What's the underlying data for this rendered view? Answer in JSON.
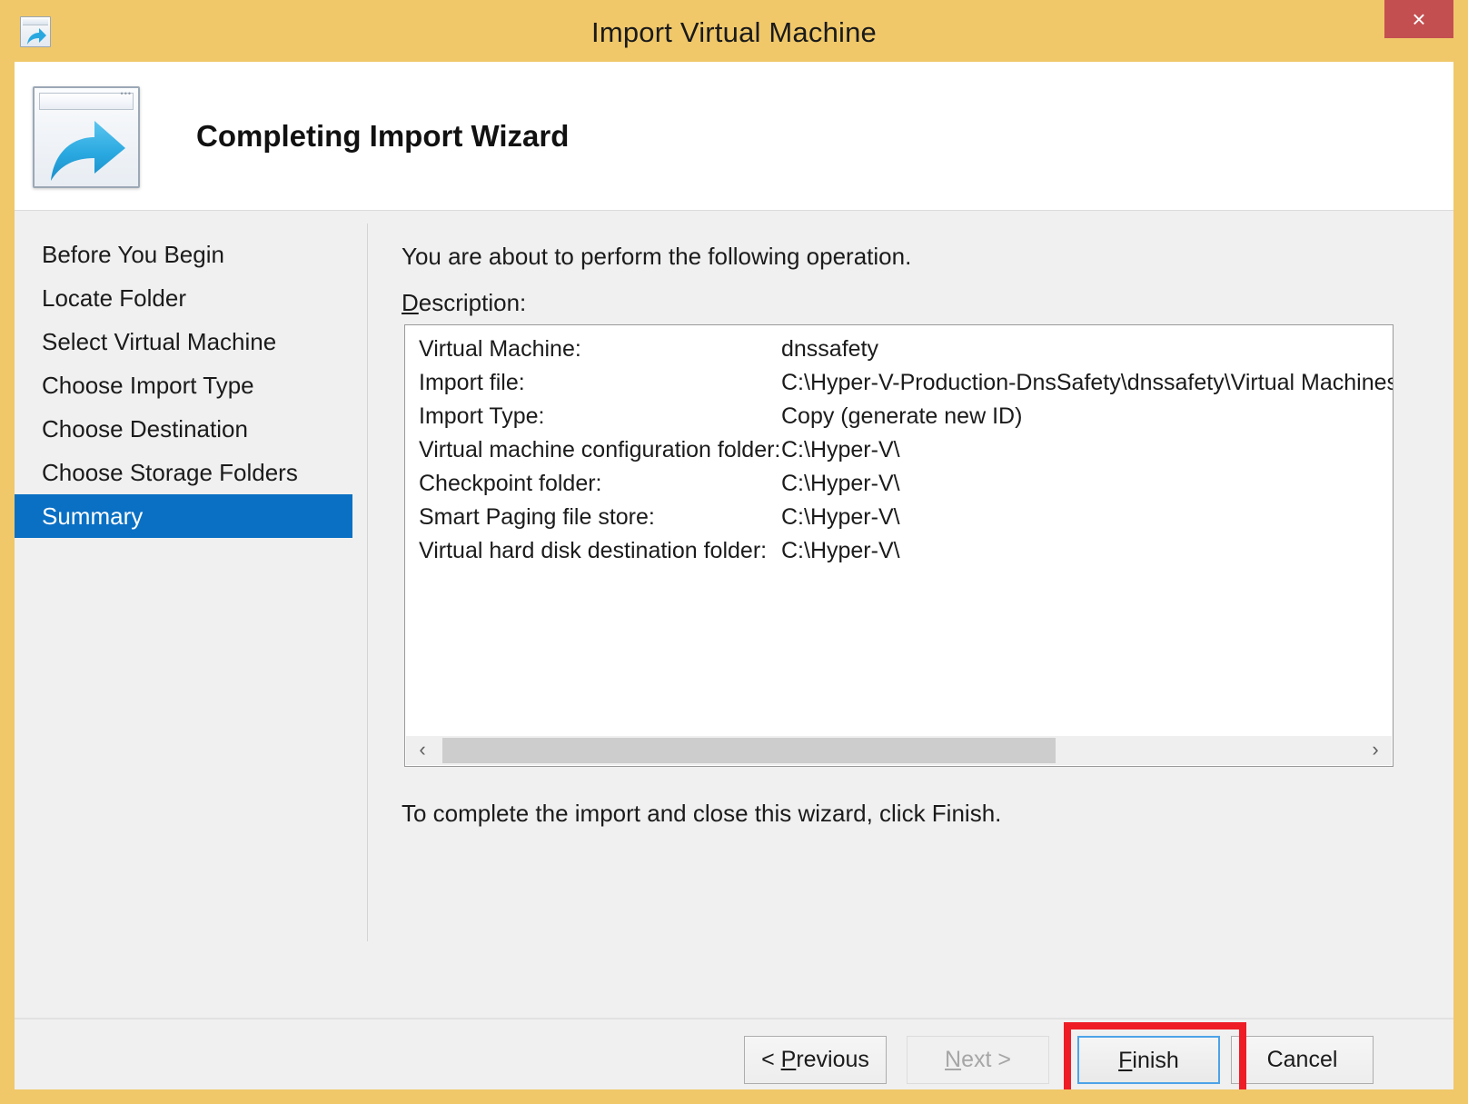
{
  "window": {
    "title": "Import Virtual Machine",
    "close_label": "×",
    "icon": "import-vm-window-icon",
    "chrome_color": "#f0c86a",
    "close_color": "#c44f50"
  },
  "header": {
    "title": "Completing Import Wizard",
    "icon": "wizard-arrow-icon"
  },
  "sidebar": {
    "items": [
      {
        "label": "Before You Begin",
        "active": false
      },
      {
        "label": "Locate Folder",
        "active": false
      },
      {
        "label": "Select Virtual Machine",
        "active": false
      },
      {
        "label": "Choose Import Type",
        "active": false
      },
      {
        "label": "Choose Destination",
        "active": false
      },
      {
        "label": "Choose Storage Folders",
        "active": false
      },
      {
        "label": "Summary",
        "active": true
      }
    ],
    "active_color": "#0a70c4"
  },
  "main": {
    "intro": "You are about to perform the following operation.",
    "description_label": "Description:",
    "description_accel": "D",
    "footnote": "To complete the import and close this wizard, click Finish.",
    "summary_rows": [
      {
        "label": "Virtual Machine:",
        "value": "dnssafety"
      },
      {
        "label": "Import file:",
        "value": "C:\\Hyper-V-Production-DnsSafety\\dnssafety\\Virtual Machines\\"
      },
      {
        "label": "Import Type:",
        "value": "Copy (generate new ID)"
      },
      {
        "label": "Virtual machine configuration folder:",
        "value": "C:\\Hyper-V\\"
      },
      {
        "label": "Checkpoint folder:",
        "value": "C:\\Hyper-V\\"
      },
      {
        "label": "Smart Paging file store:",
        "value": "C:\\Hyper-V\\"
      },
      {
        "label": "Virtual hard disk destination folder:",
        "value": "C:\\Hyper-V\\"
      }
    ],
    "scrollbar": {
      "left_arrow": "‹",
      "right_arrow": "›"
    }
  },
  "footer": {
    "buttons": [
      {
        "id": "previous",
        "label": "< Previous",
        "accel": "P",
        "state": "enabled"
      },
      {
        "id": "next",
        "label": "Next >",
        "accel": "N",
        "state": "disabled"
      },
      {
        "id": "finish",
        "label": "Finish",
        "accel": "F",
        "state": "focused"
      },
      {
        "id": "cancel",
        "label": "Cancel",
        "accel": "",
        "state": "enabled"
      }
    ]
  },
  "annotation": {
    "target": "finish-button",
    "color": "#ee1c25"
  }
}
